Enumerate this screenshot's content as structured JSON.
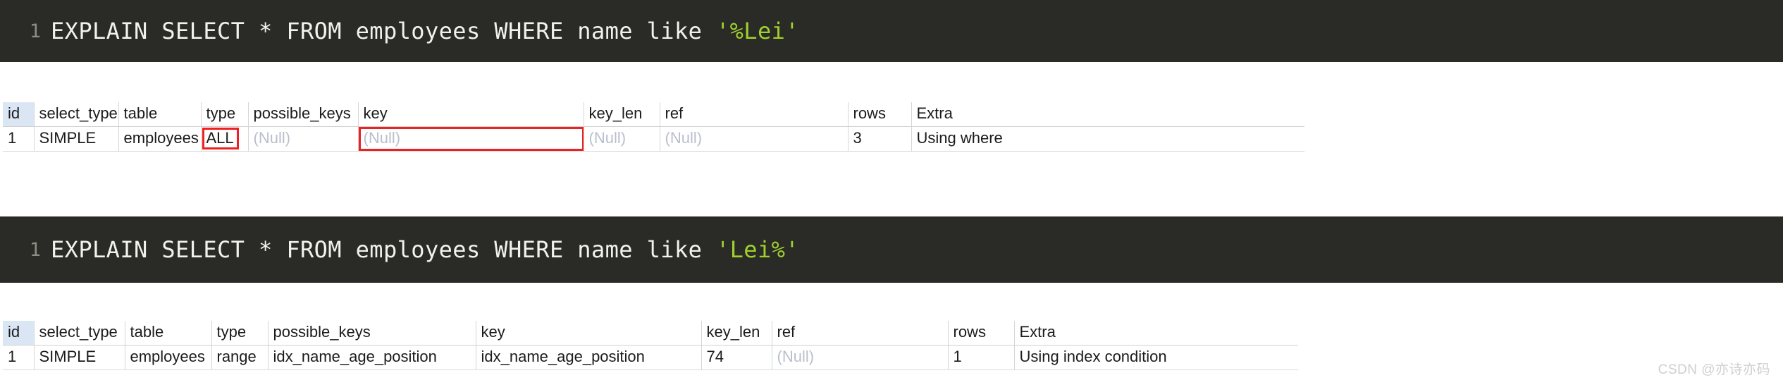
{
  "colors": {
    "editor_background": "#2a2a26",
    "editor_text": "#f2f2ec",
    "string_literal": "#9fd02e",
    "line_number": "#8d8d85",
    "header_id_background": "#dbe6f4",
    "null_text": "#b9bfcc",
    "highlight_outline": "#ef2020",
    "page_background": "#ffffff"
  },
  "blocks": [
    {
      "line_number": "1",
      "sql_prefix": "EXPLAIN SELECT * FROM employees WHERE name like ",
      "sql_string": "'%Lei'",
      "table": {
        "columns": [
          "id",
          "select_type",
          "table",
          "type",
          "possible_keys",
          "key",
          "key_len",
          "ref",
          "rows",
          "Extra"
        ],
        "row": {
          "id": "1",
          "select_type": "SIMPLE",
          "table": "employees",
          "type": "ALL",
          "possible_keys": "(Null)",
          "key": "(Null)",
          "key_len": "(Null)",
          "ref": "(Null)",
          "rows": "3",
          "extra": "Using where"
        }
      }
    },
    {
      "line_number": "1",
      "sql_prefix": "EXPLAIN SELECT * FROM employees WHERE name like ",
      "sql_string": "'Lei%'",
      "table": {
        "columns": [
          "id",
          "select_type",
          "table",
          "type",
          "possible_keys",
          "key",
          "key_len",
          "ref",
          "rows",
          "Extra"
        ],
        "row": {
          "id": "1",
          "select_type": "SIMPLE",
          "table": "employees",
          "type": "range",
          "possible_keys": "idx_name_age_position",
          "key": "idx_name_age_position",
          "key_len": "74",
          "ref": "(Null)",
          "rows": "1",
          "extra": "Using index condition"
        }
      }
    }
  ],
  "watermark": {
    "text": "CSDN @亦诗亦码"
  }
}
